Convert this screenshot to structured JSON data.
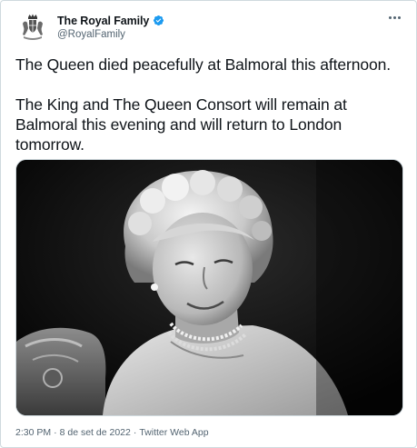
{
  "author": {
    "display_name": "The Royal Family",
    "handle": "@RoyalFamily",
    "avatar_icon": "royal-coat-of-arms-icon",
    "verified": true
  },
  "tweet": {
    "paragraph_1": "The Queen died peacefully at Balmoral this afternoon.",
    "paragraph_2": "The King and The Queen Consort will remain at Balmoral this evening and will return to London tomorrow."
  },
  "media": {
    "type": "black-and-white portrait photograph"
  },
  "meta": {
    "time": "2:30 PM",
    "separator": "·",
    "date": "8 de set de 2022",
    "source": "Twitter Web App"
  },
  "colors": {
    "verified_blue": "#1d9bf0",
    "text_primary": "#0f1419",
    "text_secondary": "#536471",
    "border": "#cfd9de"
  }
}
